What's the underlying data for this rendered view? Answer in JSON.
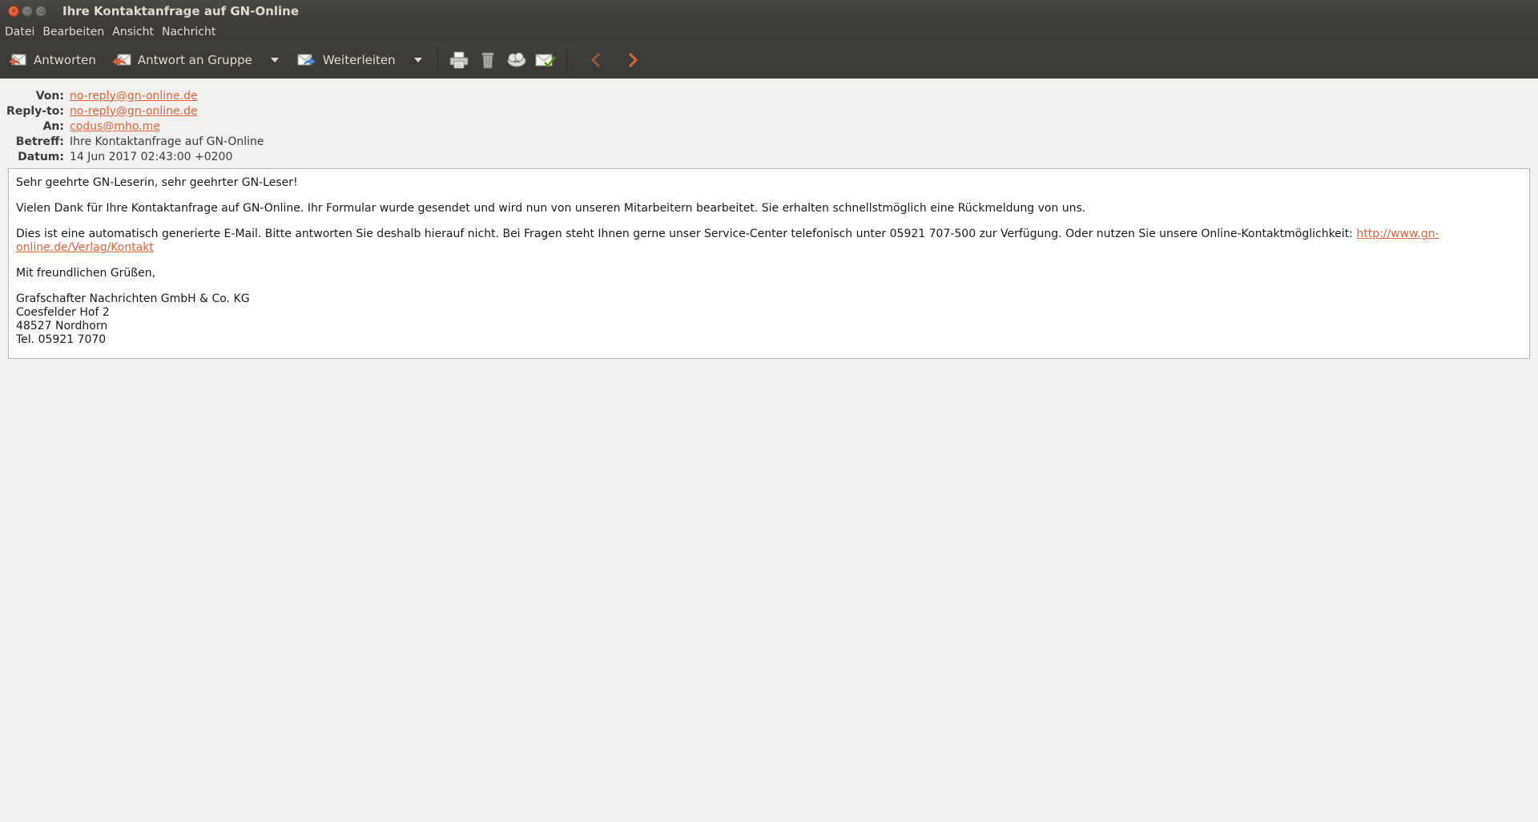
{
  "window": {
    "title": "Ihre Kontaktanfrage auf GN-Online",
    "close_glyph": "×",
    "minimize_glyph": "−",
    "maximize_glyph": "▫"
  },
  "menu": {
    "items": [
      "Datei",
      "Bearbeiten",
      "Ansicht",
      "Nachricht"
    ]
  },
  "toolbar": {
    "reply_label": "Antworten",
    "reply_group_label": "Antwort an Gruppe",
    "forward_label": "Weiterleiten",
    "icons": [
      "reply-icon",
      "reply-all-icon",
      "forward-icon",
      "print-icon",
      "trash-icon",
      "junk-icon",
      "mark-read-icon",
      "previous-arrow-icon",
      "next-arrow-icon"
    ],
    "accent": "#e4643a"
  },
  "headers": {
    "from_label": "Von:",
    "from_value": "no-reply@gn-online.de",
    "replyto_label": "Reply-to:",
    "replyto_value": "no-reply@gn-online.de",
    "to_label": "An:",
    "to_value": "codus@mho.me",
    "subject_label": "Betreff:",
    "subject_value": "Ihre Kontaktanfrage auf GN-Online",
    "date_label": "Datum:",
    "date_value": "14 Jun 2017 02:43:00 +0200"
  },
  "message": {
    "greeting": "Sehr geehrte GN-Leserin, sehr geehrter GN-Leser!",
    "para1": "Vielen Dank für Ihre Kontaktanfrage auf GN-Online. Ihr Formular wurde gesendet und wird nun von unseren Mitarbeitern bearbeitet. Sie erhalten schnellstmöglich eine Rückmeldung von uns.",
    "para2": "Dies ist eine automatisch generierte E-Mail. Bitte antworten Sie deshalb hierauf nicht. Bei Fragen steht Ihnen gerne unser Service-Center telefonisch unter 05921 707-500 zur Verfügung. Oder nutzen Sie unsere Online-Kontaktmöglichkeit: ",
    "link_line1": "http://www.gn-",
    "link_line2": "online.de/Verlag/Kontakt",
    "closing": "Mit freundlichen Grüßen,",
    "sig_company": "Grafschafter Nachrichten GmbH & Co. KG",
    "sig_street": "Coesfelder Hof 2",
    "sig_city": "48527 Nordhorn",
    "sig_phone": "Tel. 05921 7070"
  }
}
